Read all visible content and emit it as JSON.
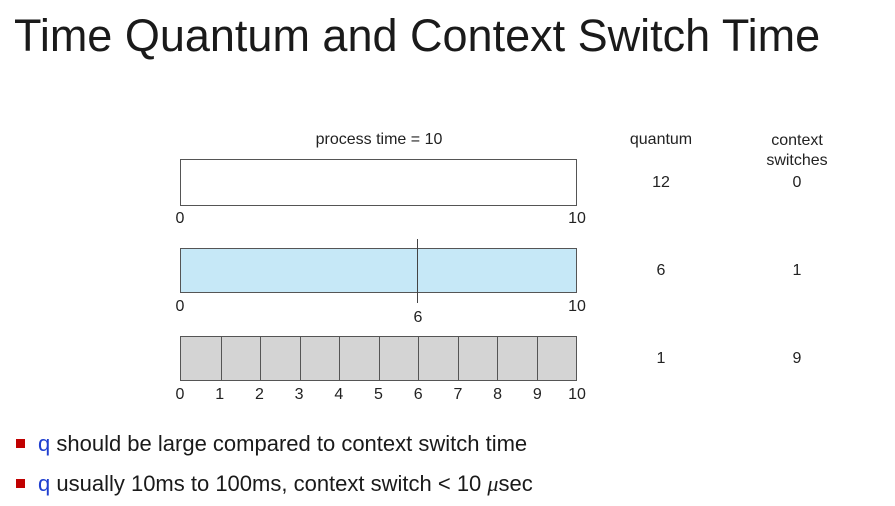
{
  "title": "Time Quantum and Context Switch Time",
  "diagram": {
    "header": "process time = 10",
    "column_quantum": "quantum",
    "column_context": "context\nswitches",
    "rows": [
      {
        "quantum": "12",
        "switches": "0",
        "start_label": "0",
        "end_label": "10",
        "fill": "#ffffff",
        "divisions": 1,
        "marker_label": ""
      },
      {
        "quantum": "6",
        "switches": "1",
        "start_label": "0",
        "end_label": "10",
        "fill": "#c6e8f7",
        "divisions": 2,
        "marker_label": "6"
      },
      {
        "quantum": "1",
        "switches": "9",
        "fill": "#d4d4d4",
        "divisions": 10,
        "ticks": [
          "0",
          "1",
          "2",
          "3",
          "4",
          "5",
          "6",
          "7",
          "8",
          "9",
          "10"
        ]
      }
    ]
  },
  "bullets": [
    {
      "q": "q",
      "text": " should be large compared to context switch time"
    },
    {
      "q": "q",
      "text_before": " usually 10ms to 100ms, context switch < 10 ",
      "mu": "μ",
      "text_after": "sec"
    }
  ],
  "colors": {
    "bullet": "#c00000",
    "q": "#1f3fd0",
    "border": "#555555"
  }
}
